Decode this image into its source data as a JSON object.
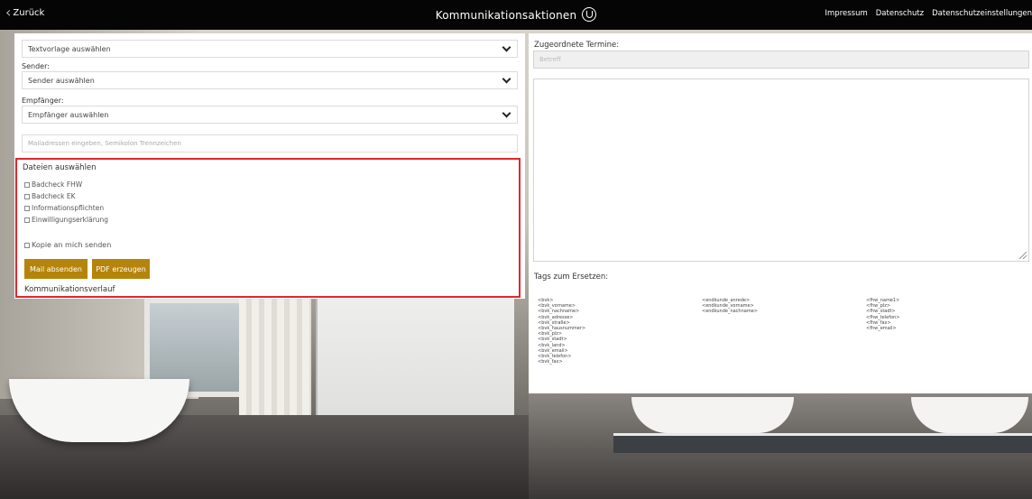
{
  "topbar": {
    "back_label": "Zurück",
    "title": "Kommunikationsaktionen",
    "links": [
      "Impressum",
      "Datenschutz",
      "Datenschutzeinstellungen"
    ]
  },
  "form": {
    "template_select": "Textvorlage auswählen",
    "sender_label": "Sender:",
    "sender_select": "Sender auswählen",
    "recipient_label": "Empfänger:",
    "recipient_select": "Empfänger auswählen",
    "mail_placeholder": "Mailadressen eingeben, Semikolon Trennzeichen"
  },
  "files": {
    "title": "Dateien auswählen",
    "items": [
      "Badcheck FHW",
      "Badcheck EK",
      "Informationspflichten",
      "Einwilligungserklärung"
    ],
    "copy_label": "Kopie an mich senden",
    "send_button": "Mail absenden",
    "pdf_button": "PDF erzeugen",
    "history_label": "Kommunikationsverlauf"
  },
  "right": {
    "appointments_label": "Zugeordnete Termine:",
    "subject_placeholder": "Betreff",
    "tags_label": "Tags zum Ersetzen:",
    "tags_col1": [
      "<bvk>",
      "<bvk_vorname>",
      "<bvk_nachname>",
      "<bvk_adresse>",
      "<bvk_straße>",
      "<bvk_hausnummer>",
      "<bvk_plz>",
      "<bvk_stadt>",
      "<bvk_land>",
      "<bvk_email>",
      "<bvk_telefon>",
      "<bvk_fax>"
    ],
    "tags_col2": [
      "<endkunde_anrede>",
      "<endkunde_vorname>",
      "<endkunde_nachname>"
    ],
    "tags_col3": [
      "<fhw_name1>",
      "<fhw_plz>",
      "<fhw_stadt>",
      "<fhw_telefon>",
      "<fhw_fax>",
      "<fhw_email>"
    ]
  },
  "colors": {
    "topbar": "#050505",
    "button": "#b5840a",
    "highlight_border": "#e3262d"
  }
}
